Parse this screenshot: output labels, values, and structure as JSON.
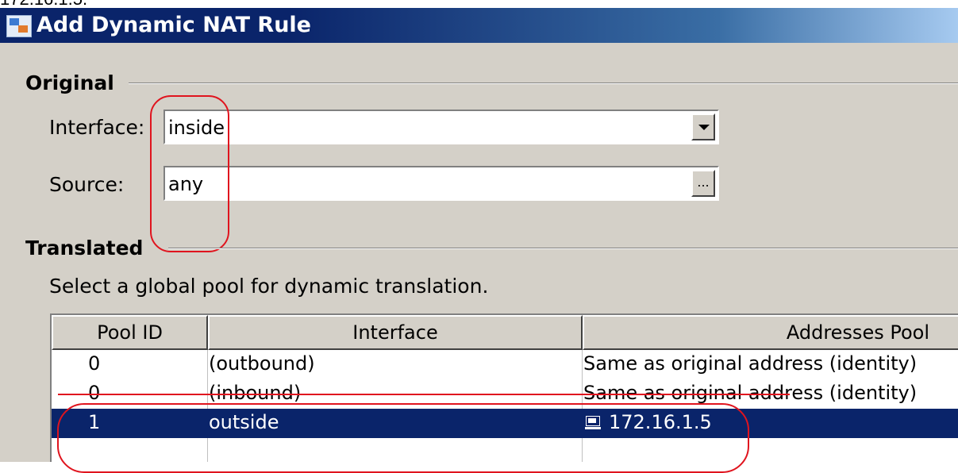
{
  "top_fragment": "172.16.1.5.",
  "window": {
    "title": "Add Dynamic NAT Rule",
    "icon": "nat-rule-icon"
  },
  "original": {
    "section_label": "Original",
    "interface_label": "Interface:",
    "interface_value": "inside",
    "source_label": "Source:",
    "source_value": "any",
    "browse_label": "..."
  },
  "translated": {
    "section_label": "Translated",
    "instruction": "Select a global pool for dynamic translation.",
    "columns": [
      "Pool ID",
      "Interface",
      "Addresses Pool"
    ],
    "rows": [
      {
        "pool_id": "0",
        "interface": "(outbound)",
        "addresses": "Same as original address (identity)",
        "selected": false
      },
      {
        "pool_id": "0",
        "interface": "(inbound)",
        "addresses": "Same as original address (identity)",
        "selected": false
      },
      {
        "pool_id": "1",
        "interface": "outside",
        "addresses": "172.16.1.5",
        "selected": true,
        "address_icon": "host-icon"
      }
    ]
  },
  "colors": {
    "title_bar_start": "#0a246a",
    "title_bar_end": "#a6caf0",
    "selection": "#0a246a",
    "annotation": "#e0141e",
    "dialog_bg": "#d4d0c8"
  }
}
